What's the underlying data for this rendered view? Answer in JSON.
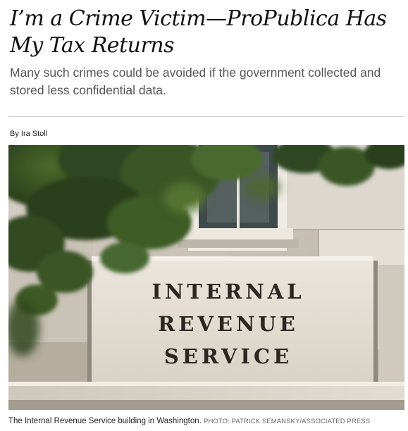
{
  "article": {
    "headline": "I’m a Crime Victim—ProPublica Has My Tax Returns",
    "dek": "Many such crimes could be avoided if the government collected and stored less confidential data.",
    "byline": "By Ira Stoll"
  },
  "photo": {
    "sign_lines": [
      "INTERNAL",
      "REVENUE",
      "SERVICE"
    ],
    "caption": "The Internal Revenue Service building in Washington.",
    "credit": "PHOTO: PATRICK SEMANSKY/ASSOCIATED PRESS"
  }
}
